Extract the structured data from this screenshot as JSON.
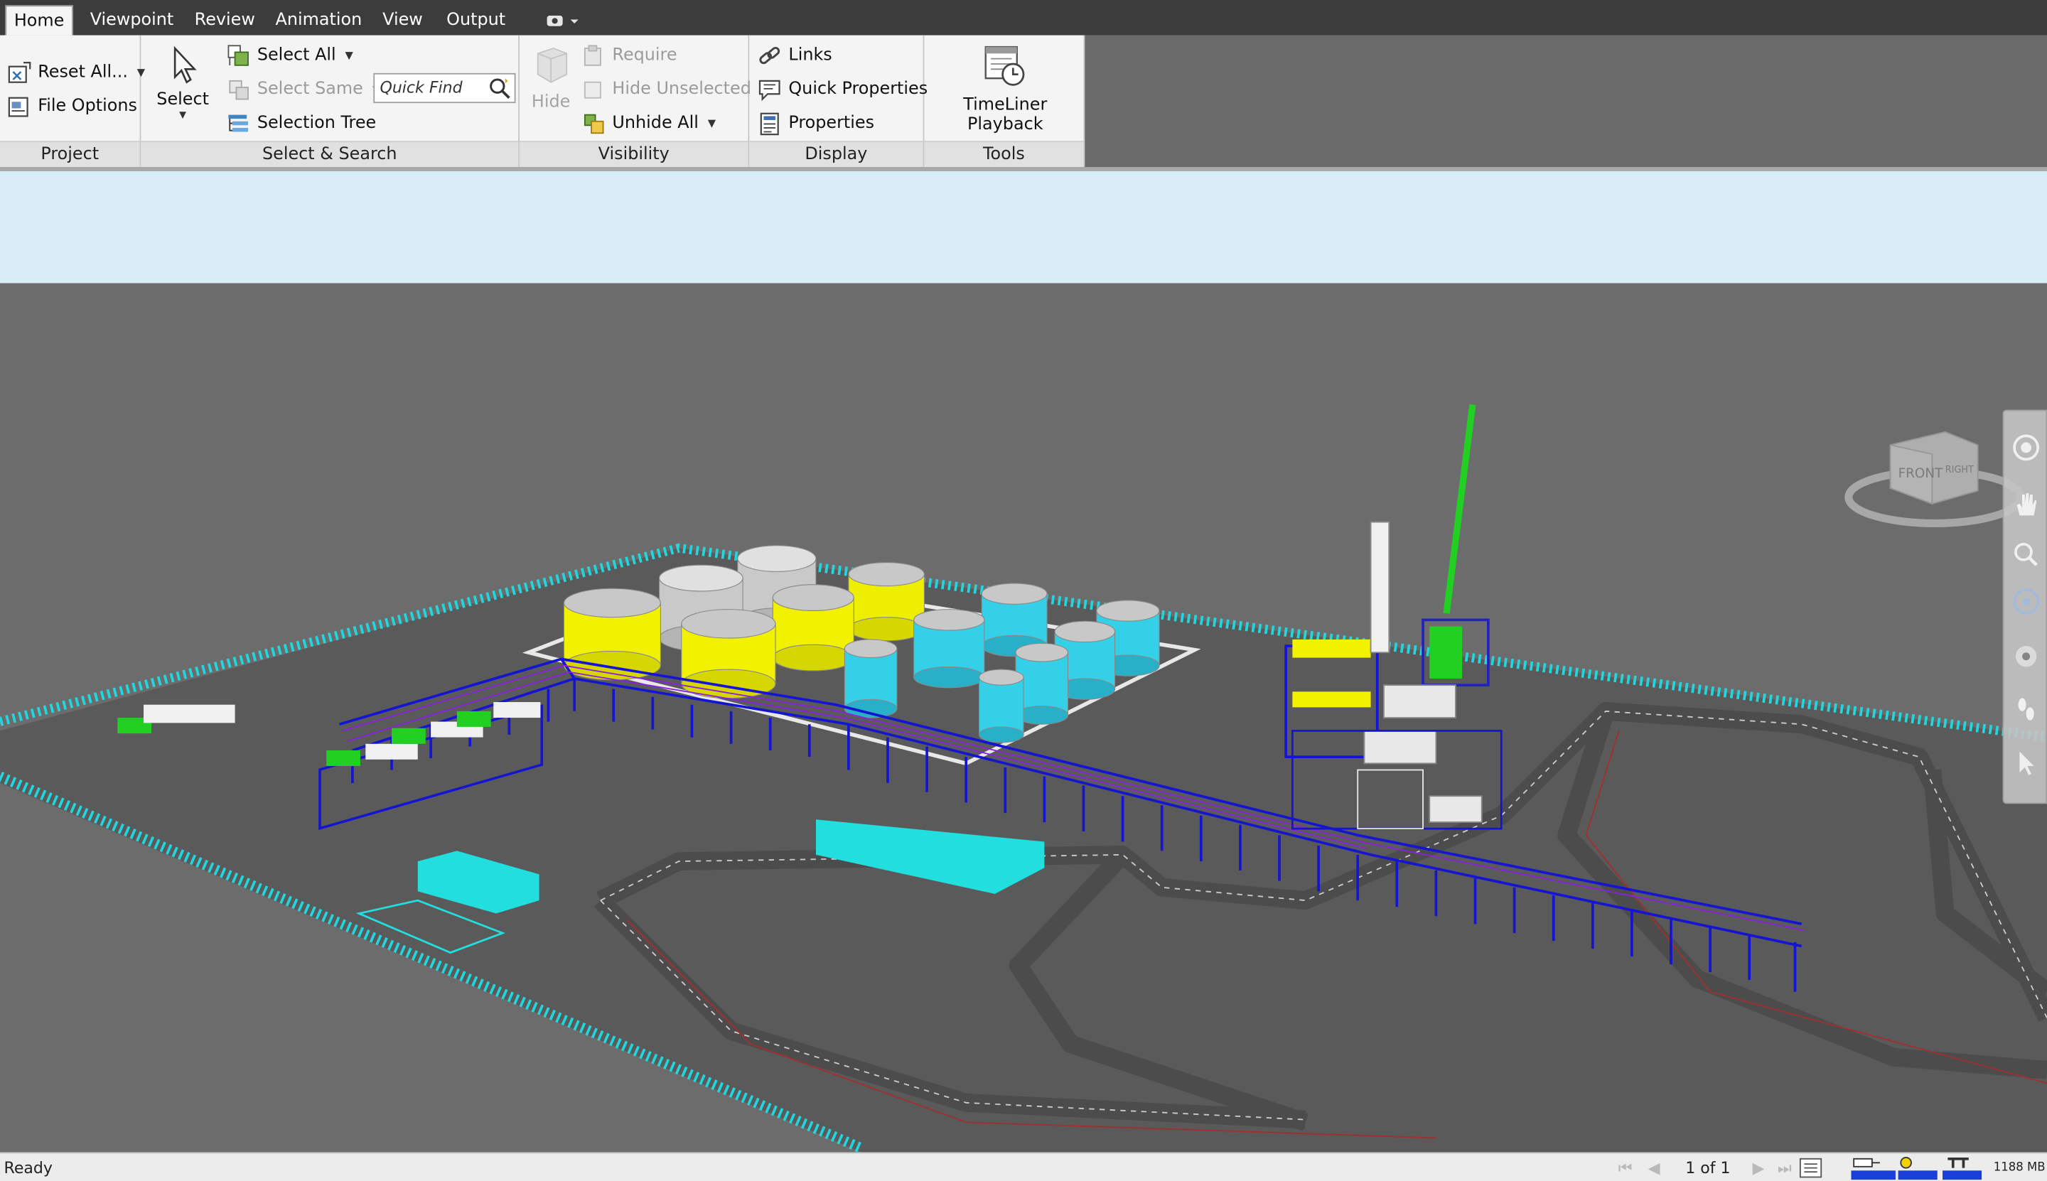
{
  "tabs": [
    {
      "label": "Home",
      "active": true
    },
    {
      "label": "Viewpoint"
    },
    {
      "label": "Review"
    },
    {
      "label": "Animation"
    },
    {
      "label": "View"
    },
    {
      "label": "Output"
    }
  ],
  "ribbon": {
    "project": {
      "title": "Project",
      "reset_all": "Reset All...",
      "file_options": "File Options"
    },
    "select_search": {
      "title": "Select & Search",
      "select": "Select",
      "select_all": "Select All",
      "select_same": "Select Same",
      "selection_tree": "Selection Tree",
      "quick_find_placeholder": "Quick Find"
    },
    "visibility": {
      "title": "Visibility",
      "hide": "Hide",
      "require": "Require",
      "hide_unselected": "Hide Unselected",
      "unhide_all": "Unhide All"
    },
    "display": {
      "title": "Display",
      "links": "Links",
      "quick_properties": "Quick Properties",
      "properties": "Properties"
    },
    "tools": {
      "title": "Tools",
      "timeliner_playback": "TimeLiner Playback"
    }
  },
  "viewcube": {
    "front": "FRONT",
    "right": "RIGHT"
  },
  "navbar_icons": [
    "steering-wheel-icon",
    "pan-icon",
    "zoom-icon",
    "orbit-icon",
    "look-icon",
    "walk-icon",
    "select-icon"
  ],
  "status": {
    "ready": "Ready",
    "page": "1 of 1",
    "memory": "1188 MB"
  },
  "colors": {
    "tank_yellow": "#f2f200",
    "tank_grey": "#c8c8c8",
    "tank_cyan": "#33d0e8",
    "piperack": "#1010d0",
    "fence": "#20d8e0",
    "sky": "#d6ecf8",
    "ground": "#6f6f6f"
  }
}
